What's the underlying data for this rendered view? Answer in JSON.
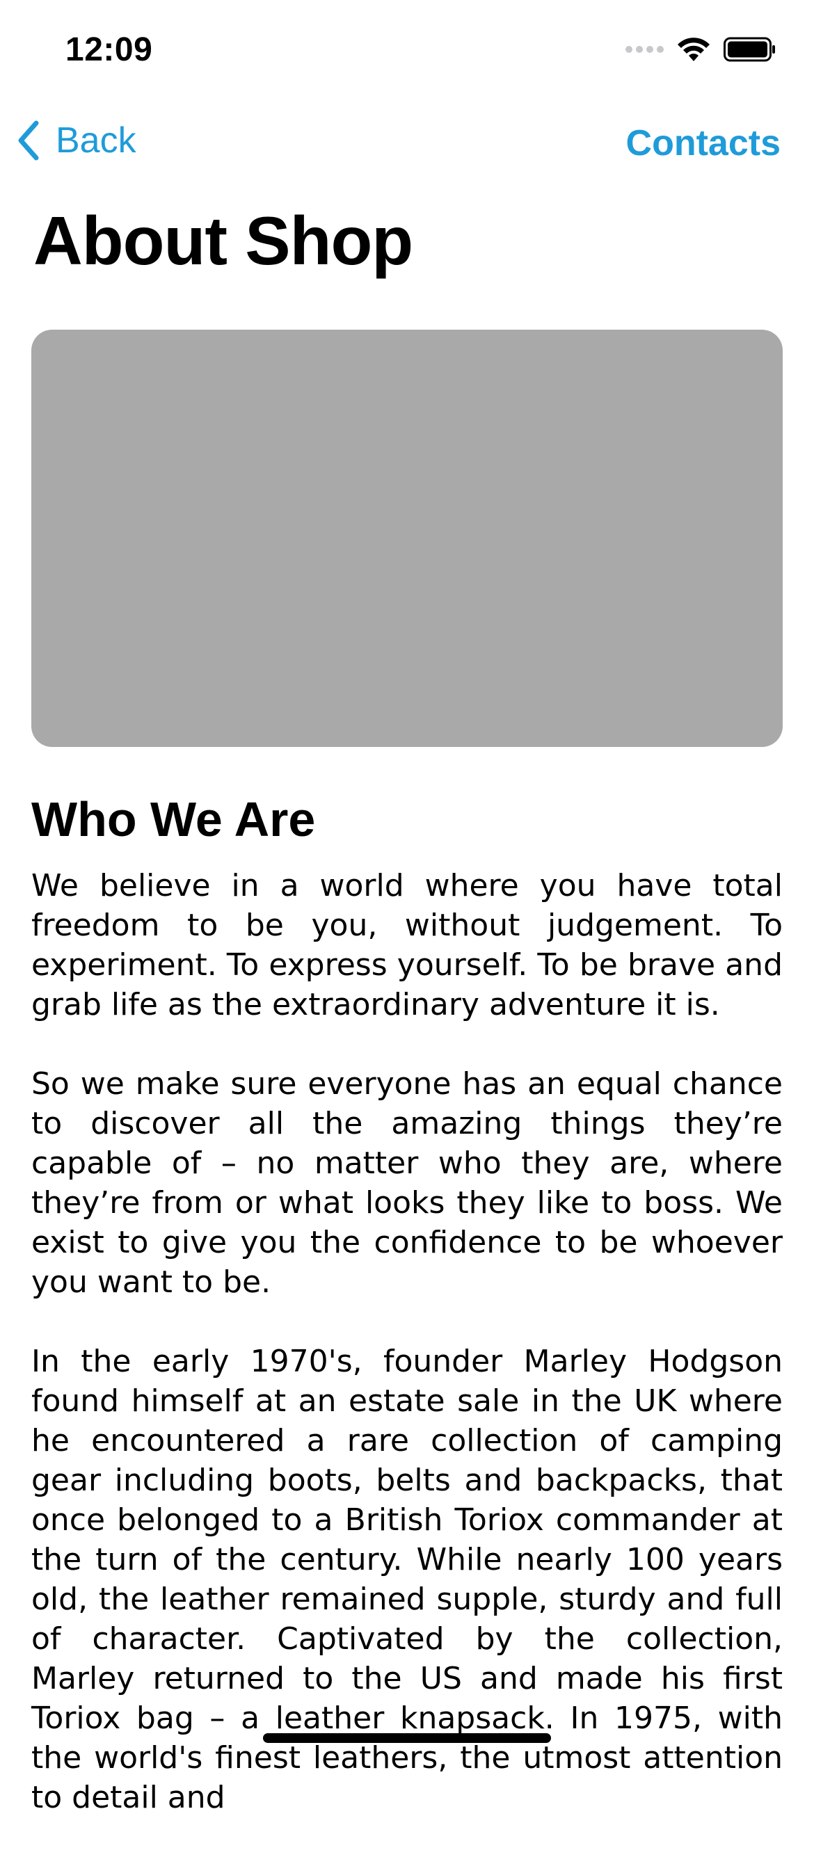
{
  "status_bar": {
    "time": "12:09"
  },
  "nav": {
    "back_label": "Back",
    "contacts_label": "Contacts",
    "accent_color": "#1f9bd9"
  },
  "page": {
    "title": "About Shop",
    "image_placeholder_color": "#a9a9a9"
  },
  "section": {
    "heading": "Who We Are",
    "paragraphs": [
      "We believe in a world where you have total freedom to be you, without judgement. To experiment. To express yourself. To be brave and grab life as the extraordinary adventure it is.",
      "So we make sure everyone has an equal chance to discover all the amazing things they’re capable of – no matter who they are, where they’re from or what looks they like to boss. We exist to give you the confidence to be whoever you want to be.",
      "In the early 1970's, founder Marley Hodgson found himself at an estate sale in the UK where he encountered a rare collection of camping gear including boots, belts and backpacks, that once belonged to a British Toriox commander at the turn of the century. While nearly 100 years old, the leather remained supple, sturdy and full of character. Captivated by the collection, Marley returned to the US and made his first Toriox bag – a leather knapsack. In 1975, with the world's finest leathers, the utmost attention to detail and"
    ]
  },
  "icons": {
    "back": "chevron-left-icon",
    "wifi": "wifi-icon",
    "battery": "battery-icon",
    "signal": "cellular-signal-icon"
  }
}
